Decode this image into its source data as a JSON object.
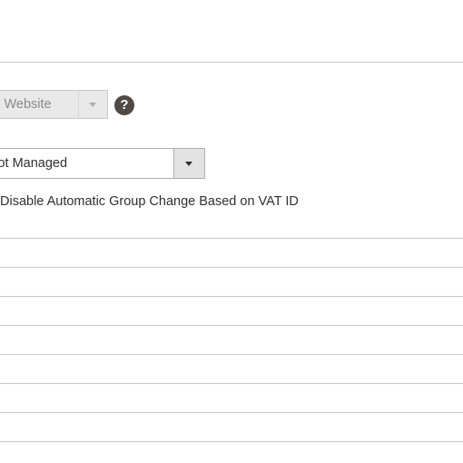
{
  "account_information": {
    "associate_to_website": {
      "selected": "Main Website",
      "disabled": true,
      "help_icon": "question-icon"
    },
    "group": {
      "selected": "Not Managed"
    },
    "disable_auto_group_change": {
      "label": "Disable Automatic Group Change Based on VAT ID"
    },
    "empty_fields": [
      "",
      "",
      "",
      "",
      "",
      "",
      "",
      ""
    ]
  },
  "colors": {
    "border": "#c9c9c9",
    "help_icon_bg": "#514943",
    "disabled_bg": "#e9e9e9",
    "text": "#303030"
  }
}
